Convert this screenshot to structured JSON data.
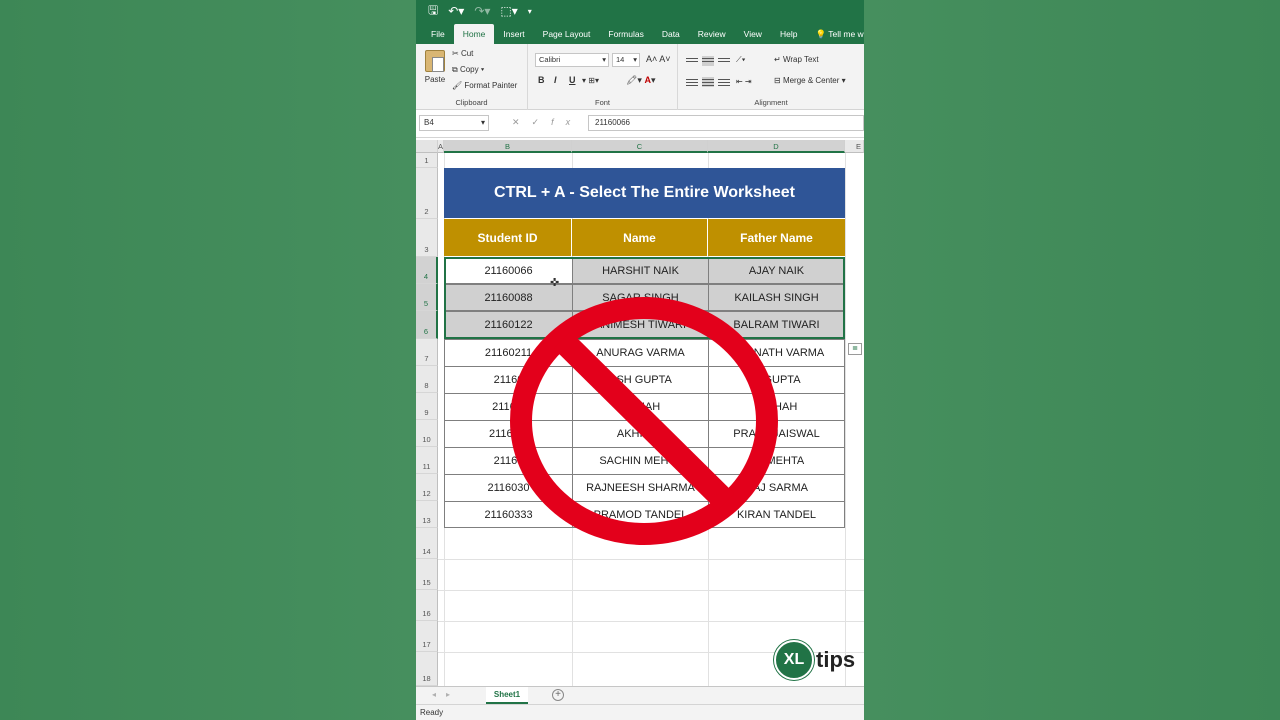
{
  "app": {
    "tabs": [
      "File",
      "Home",
      "Insert",
      "Page Layout",
      "Formulas",
      "Data",
      "Review",
      "View",
      "Help",
      "Tell me w"
    ],
    "active_tab": "Home"
  },
  "ribbon": {
    "clipboard": {
      "paste": "Paste",
      "cut": "Cut",
      "copy": "Copy",
      "format_painter": "Format Painter",
      "label": "Clipboard"
    },
    "font": {
      "name": "Calibri",
      "size": "14",
      "bold": "B",
      "italic": "I",
      "underline": "U",
      "label": "Font"
    },
    "alignment": {
      "wrap_text": "Wrap Text",
      "merge_center": "Merge & Center",
      "label": "Alignment"
    }
  },
  "formula_bar": {
    "name_box": "B4",
    "value": "21160066"
  },
  "columns": [
    "A",
    "B",
    "C",
    "D",
    "E"
  ],
  "rows": [
    "1",
    "2",
    "3",
    "4",
    "5",
    "6",
    "7",
    "8",
    "9",
    "10",
    "11",
    "12",
    "13",
    "14",
    "15",
    "16",
    "17",
    "18"
  ],
  "sheet": {
    "title": "CTRL + A - Select The Entire Worksheet",
    "headers": [
      "Student ID",
      "Name",
      "Father Name"
    ],
    "data": [
      [
        "21160066",
        "HARSHIT NAIK",
        "AJAY NAIK"
      ],
      [
        "21160088",
        "SAGAR SINGH",
        "KAILASH SINGH"
      ],
      [
        "21160122",
        "ANIMESH TIWARI",
        "BALRAM TIWARI"
      ],
      [
        "21160211",
        "ANURAG VARMA",
        "SOMNATH VARMA"
      ],
      [
        "21160",
        "ASH GUPTA",
        "R GUPTA"
      ],
      [
        "2116 7",
        "AT HAH",
        "AN HAH"
      ],
      [
        "2116 36",
        "AKHIL JA",
        "PRAKA JAISWAL"
      ],
      [
        "21160",
        "SACHIN MEHTA",
        "RA MEHTA"
      ],
      [
        "2116030",
        "RAJNEESH SHARMA",
        "RAJ SARMA"
      ],
      [
        "21160333",
        "PRAMOD TANDEL",
        "KIRAN TANDEL"
      ]
    ]
  },
  "logo": {
    "xl": "XL",
    "tips": "tips"
  },
  "sheet_tab": "Sheet1",
  "status": "Ready",
  "colors": {
    "excel_green": "#217346",
    "title_blue": "#2f5597",
    "header_gold": "#bf9000",
    "no_sign_red": "#e3001b"
  }
}
